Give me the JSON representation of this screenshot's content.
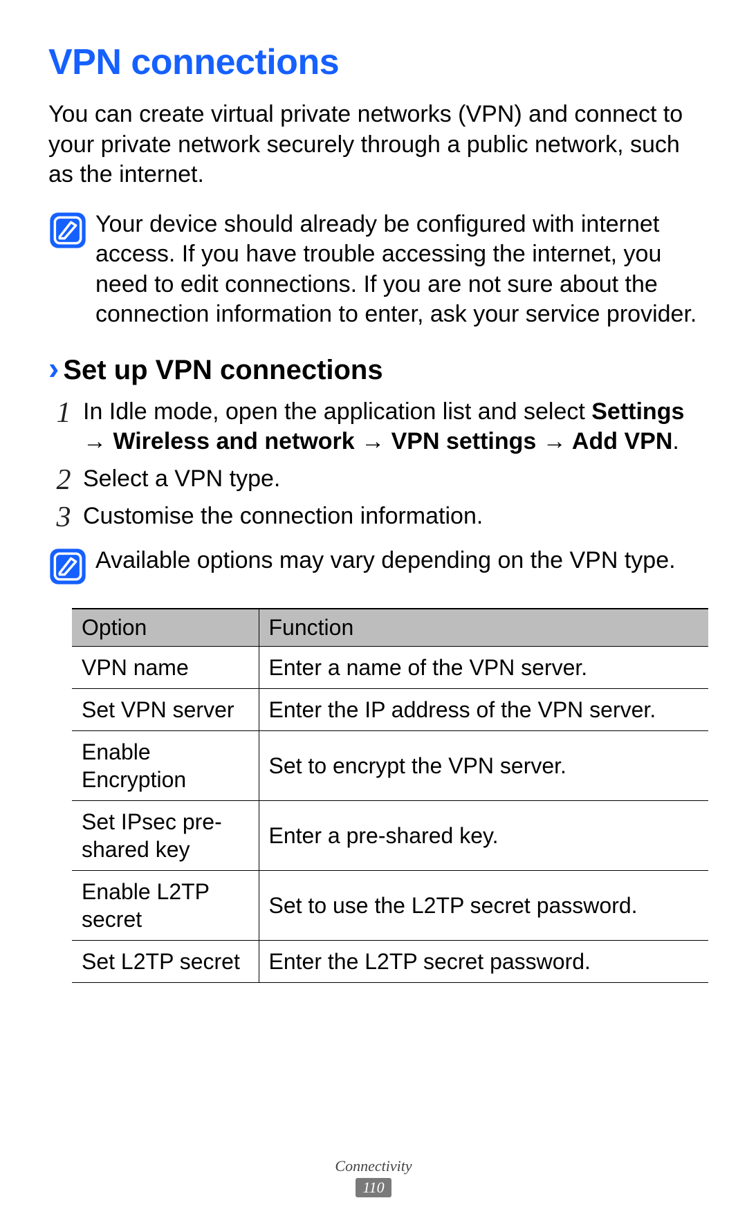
{
  "title": "VPN connections",
  "intro": "You can create virtual private networks (VPN) and connect to your private network securely through a public network, such as the internet.",
  "note1": "Your device should already be configured with internet access. If you have trouble accessing the internet, you need to edit connections. If you are not sure about the connection information to enter, ask your service provider.",
  "subhead_chevron": "›",
  "subhead": "Set up VPN connections",
  "steps": {
    "s1_num": "1",
    "s1_a": "In Idle mode, open the application list and select ",
    "s1_b": "Settings → Wireless and network → VPN settings → Add VPN",
    "s1_c": ".",
    "s2_num": "2",
    "s2": "Select a VPN type.",
    "s3_num": "3",
    "s3": "Customise the connection information."
  },
  "note2": "Available options may vary depending on the VPN type.",
  "table": {
    "h_option": "Option",
    "h_function": "Function",
    "rows": [
      {
        "opt": "VPN name",
        "fn": "Enter a name of the VPN server."
      },
      {
        "opt": "Set VPN server",
        "fn": "Enter the IP address of the VPN server."
      },
      {
        "opt": "Enable Encryption",
        "fn": "Set to encrypt the VPN server."
      },
      {
        "opt": "Set IPsec pre-shared key",
        "fn": "Enter a pre-shared key."
      },
      {
        "opt": "Enable L2TP secret",
        "fn": "Set to use the L2TP secret password."
      },
      {
        "opt": "Set L2TP secret",
        "fn": "Enter the L2TP secret password."
      }
    ]
  },
  "footer_section": "Connectivity",
  "page_number": "110"
}
